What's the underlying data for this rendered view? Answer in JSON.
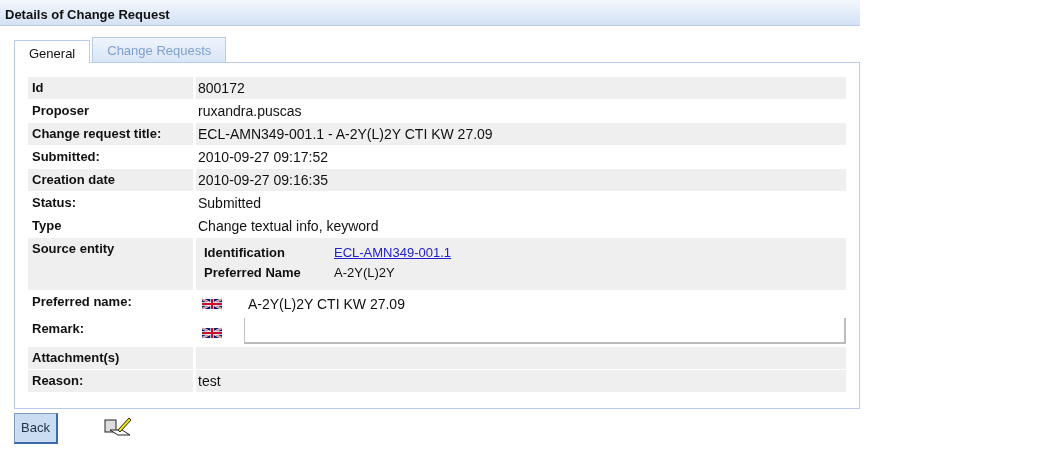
{
  "window": {
    "title": "Details of Change Request"
  },
  "tabs": [
    {
      "label": "General",
      "selected": true
    },
    {
      "label": "Change Requests",
      "selected": false
    }
  ],
  "rows": [
    {
      "kind": "text",
      "label": "Id",
      "value": "800172",
      "highlighted": true
    },
    {
      "kind": "text",
      "label": "Proposer",
      "value": "ruxandra.puscas",
      "highlighted": false
    },
    {
      "kind": "text",
      "label": "Change request title:",
      "value": "ECL-AMN349-001.1 - A-2Y(L)2Y CTI KW 27.09",
      "highlighted": true
    },
    {
      "kind": "text",
      "label": "Submitted:",
      "value": "2010-09-27 09:17:52",
      "highlighted": false
    },
    {
      "kind": "text",
      "label": "Creation date",
      "value": "2010-09-27 09:16:35",
      "highlighted": true
    },
    {
      "kind": "text",
      "label": "Status:",
      "value": "Submitted",
      "highlighted": false
    },
    {
      "kind": "text",
      "label": "Type",
      "value": "Change textual info, keyword",
      "highlighted": false
    },
    {
      "kind": "entity",
      "label": "Source entity",
      "highlighted": true,
      "fields": [
        {
          "label": "Identification",
          "value": "ECL-AMN349-001.1",
          "link": true
        },
        {
          "label": "Preferred Name",
          "value": "A-2Y(L)2Y",
          "link": false
        }
      ]
    },
    {
      "kind": "localized",
      "label": "Preferred name:",
      "value": "A-2Y(L)2Y CTI KW 27.09",
      "highlighted": false
    },
    {
      "kind": "field",
      "label": "Remark:",
      "highlighted": false
    },
    {
      "kind": "text",
      "label": "Attachment(s)",
      "highlighted": true
    },
    {
      "kind": "text",
      "label": "Reason:",
      "value": "test",
      "highlighted": true
    }
  ],
  "buttons": [
    {
      "label": "Back"
    }
  ]
}
